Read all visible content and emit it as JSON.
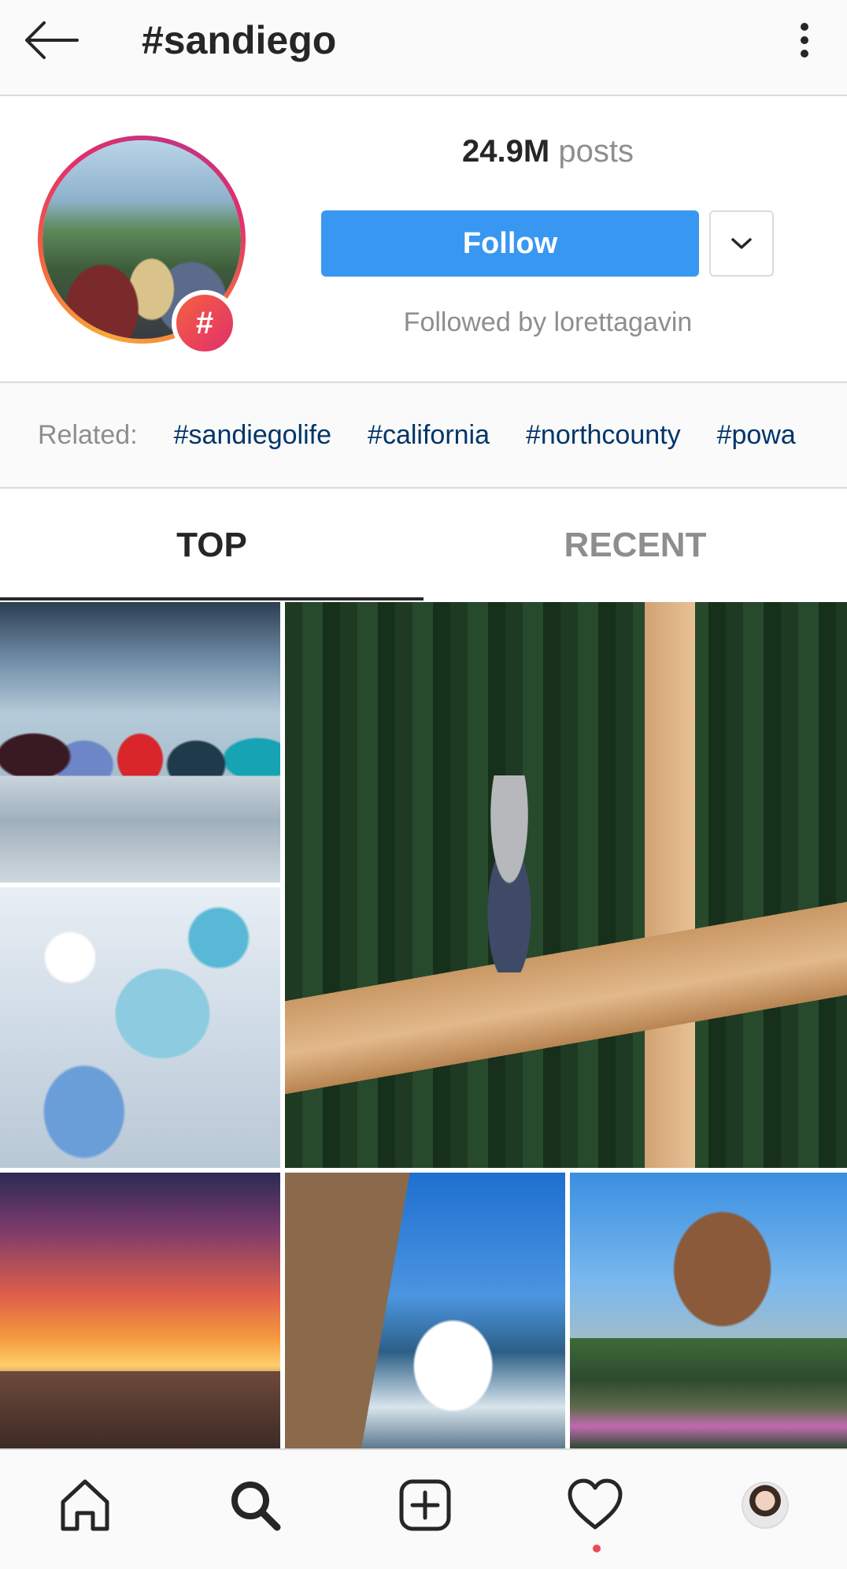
{
  "header": {
    "title": "#sandiego",
    "back_icon": "arrow-left-icon",
    "more_icon": "vertical-dots-icon"
  },
  "profile": {
    "posts_count": "24.9M",
    "posts_label": "posts",
    "badge": "#",
    "follow_label": "Follow",
    "dropdown_icon": "chevron-down-icon",
    "followed_by": "Followed by lorettagavin"
  },
  "related": {
    "label": "Related:",
    "tags": [
      "#sandiegolife",
      "#california",
      "#northcounty",
      "#powa"
    ]
  },
  "tabs": {
    "top": "TOP",
    "recent": "RECENT"
  },
  "grid": {
    "tiles": [
      "news-anchors-photo",
      "log-builder-photo",
      "dessert-table-photo",
      "sunset-beach-photo",
      "wave-cliff-photo",
      "botanical-building-photo"
    ]
  },
  "bottom_nav": {
    "items": [
      "home-icon",
      "search-icon",
      "add-post-icon",
      "heart-icon",
      "profile-avatar"
    ]
  },
  "colors": {
    "accent": "#3897f0",
    "related_tag": "#003569",
    "muted": "#8e8e8e",
    "notification": "#ed4956"
  }
}
